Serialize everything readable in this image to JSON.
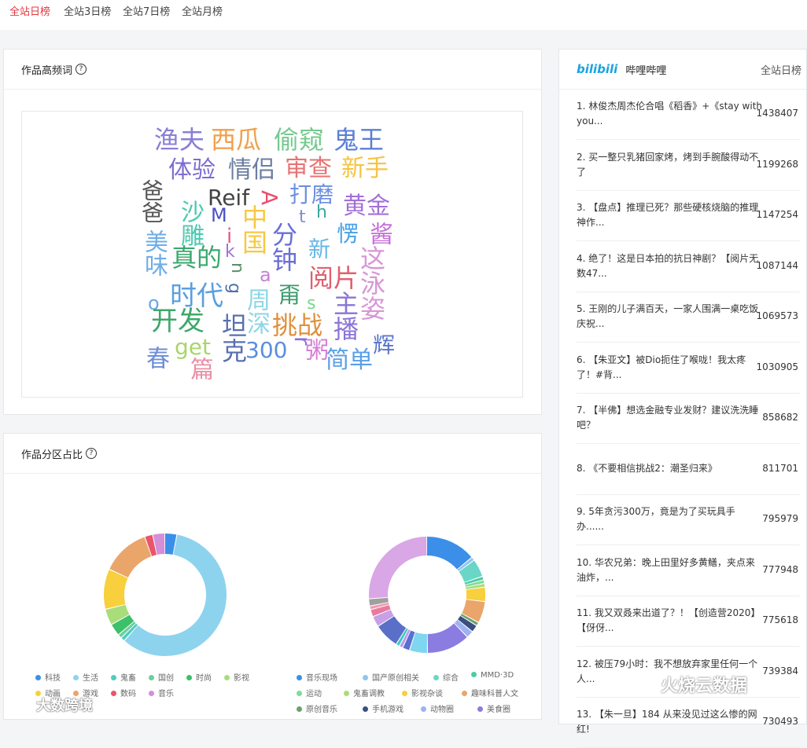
{
  "tabs": [
    "全站日榜",
    "全站3日榜",
    "全站7日榜",
    "全站月榜"
  ],
  "wordcloud_card": {
    "title": "作品高频词"
  },
  "words": [
    {
      "t": "渔夫",
      "c": "#8a7fd6"
    },
    {
      "t": "西瓜",
      "c": "#f0a04b"
    },
    {
      "t": "偷窥",
      "c": "#75c98f"
    },
    {
      "t": "鬼王",
      "c": "#5b7fd6"
    },
    {
      "t": "体验",
      "c": "#7d6bd1"
    },
    {
      "t": "情侣",
      "c": "#6c7ea0"
    },
    {
      "t": "审查",
      "c": "#e87272"
    },
    {
      "t": "新手",
      "c": "#f6c342"
    },
    {
      "t": "爸爸",
      "c": "#555"
    },
    {
      "t": "Reif",
      "c": "#444"
    },
    {
      "t": "A",
      "c": "#e8506e"
    },
    {
      "t": "打磨",
      "c": "#6c8fe0"
    },
    {
      "t": "黄金",
      "c": "#a36fd8"
    },
    {
      "t": "沙雕",
      "c": "#4cc9b0"
    },
    {
      "t": "M",
      "c": "#4a50c8"
    },
    {
      "t": "h",
      "c": "#3aa99f"
    },
    {
      "t": "t",
      "c": "#7d8fd6"
    },
    {
      "t": "中国",
      "c": "#f7c843"
    },
    {
      "t": "分钟",
      "c": "#6a6fd6"
    },
    {
      "t": "i",
      "c": "#e05a8a"
    },
    {
      "t": "愣",
      "c": "#47a0e6"
    },
    {
      "t": "酱",
      "c": "#c46fd6"
    },
    {
      "t": "美味",
      "c": "#6faee6"
    },
    {
      "t": "真的",
      "c": "#38a86c"
    },
    {
      "t": "k",
      "c": "#a86fd6"
    },
    {
      "t": "新",
      "c": "#66b8e6"
    },
    {
      "t": "这泳姿",
      "c": "#d896d6"
    },
    {
      "t": "a",
      "c": "#c880d6"
    },
    {
      "t": "阅片",
      "c": "#e0606f"
    },
    {
      "t": "n",
      "c": "#5a8f6a"
    },
    {
      "t": "g",
      "c": "#4b70b0"
    },
    {
      "t": "o",
      "c": "#6aa6e6"
    },
    {
      "t": "时代",
      "c": "#5a9fe0"
    },
    {
      "t": "周深",
      "c": "#8ed6e6"
    },
    {
      "t": "甭",
      "c": "#3a9a6a"
    },
    {
      "t": "s",
      "c": "#7ad68a"
    },
    {
      "t": "主播",
      "c": "#8a74d6"
    },
    {
      "t": "开发",
      "c": "#3ea86a"
    },
    {
      "t": "坦克",
      "c": "#5a6fb0"
    },
    {
      "t": "挑战",
      "c": "#e0903c"
    },
    {
      "t": "get",
      "c": "#a8d66a"
    },
    {
      "t": "300",
      "c": "#5a8ee0"
    },
    {
      "t": "r",
      "c": "#8a6fd6"
    },
    {
      "t": "粥",
      "c": "#d67fd6"
    },
    {
      "t": "简单",
      "c": "#5a9fe6"
    },
    {
      "t": "辉",
      "c": "#5a76c8"
    },
    {
      "t": "春",
      "c": "#6e8fd6"
    },
    {
      "t": "篇",
      "c": "#e890a6"
    }
  ],
  "pie_card": {
    "title": "作品分区占比"
  },
  "chart_data": [
    {
      "type": "pie",
      "legend": [
        "科技",
        "生活",
        "鬼畜",
        "国创",
        "时尚",
        "影视",
        "动画",
        "游戏",
        "数码",
        "音乐"
      ],
      "values": [
        3,
        55,
        1,
        1,
        3,
        4,
        10,
        12,
        2,
        3
      ],
      "colors": [
        "#3b8fe8",
        "#8ed3ee",
        "#4ecdc0",
        "#6bcfa0",
        "#3cc06a",
        "#a8dd7a",
        "#f8cf3c",
        "#eaa56a",
        "#e8556a",
        "#d48fd8"
      ]
    },
    {
      "type": "pie",
      "legend": [
        "音乐现场",
        "国产原创相关",
        "综合",
        "MMD·3D",
        "运动",
        "鬼畜调教",
        "影视杂谈",
        "趣味科普人文",
        "原创音乐",
        "手机游戏",
        "动物圈",
        "美食圈"
      ],
      "values": [
        14,
        1,
        5,
        1,
        1,
        1,
        4,
        6,
        1,
        2,
        2,
        12,
        5,
        2,
        1,
        1,
        7,
        3,
        2,
        1,
        2,
        26
      ],
      "colors": [
        "#3b8fe8",
        "#8ec6ee",
        "#6ad6c8",
        "#4ecca0",
        "#7fdc9a",
        "#a8dd7a",
        "#f8cf3c",
        "#eaa56a",
        "#6aa36a",
        "#3a4f80",
        "#9fb2f0",
        "#8a7ce0",
        "#7fd6f0",
        "#5a6fd0",
        "#b89af0",
        "#3ecbc0",
        "#5a6fc8",
        "#c8a0e6",
        "#e87aa0",
        "#f09ab0",
        "#a0a0a0",
        "#d9a6e6"
      ],
      "legend_colors": [
        "#3b8fe8",
        "#8ec6ee",
        "#6ad6c8",
        "#4ecca0",
        "#7fdc9a",
        "#a8dd7a",
        "#f8cf3c",
        "#eaa56a",
        "#6aa36a",
        "#3a4f80",
        "#9fb2f0",
        "#8a7ce0"
      ]
    }
  ],
  "rank": {
    "brand": "bilibili",
    "title": "哔哩哔哩",
    "scope": "全站日榜",
    "items": [
      {
        "title": "1. 林俊杰周杰伦合唱《稻香》+《stay with you...",
        "num": "1438407"
      },
      {
        "title": "2. 买一整只乳猪回家烤，烤到手腕酸得动不了",
        "num": "1199268"
      },
      {
        "title": "3. 【盘点】推理已死？那些硬核烧脑的推理神作...",
        "num": "1147254"
      },
      {
        "title": "4. 绝了！这是日本拍的抗日神剧？【阅片无数47...",
        "num": "1087144"
      },
      {
        "title": "5. 王刚的儿子满百天，一家人围满一桌吃饭庆祝...",
        "num": "1069573"
      },
      {
        "title": "6. 【朱亚文】被Dio扼住了喉咙！我太疼了！#背...",
        "num": "1030905"
      },
      {
        "title": "7. 【半佛】想选金融专业发财？建议洗洗睡吧？",
        "num": "858682"
      },
      {
        "title": "8. 《不要相信挑战2：潮圣归来》",
        "num": "811701"
      },
      {
        "title": "9. 5年贪污300万，竟是为了买玩具手办......",
        "num": "795979"
      },
      {
        "title": "10. 华农兄弟：晚上田里好多黄鳝，夹点来油炸，...",
        "num": "777948"
      },
      {
        "title": "11. 我又双叒来出道了？！【创造营2020】【伢伢...",
        "num": "775618"
      },
      {
        "title": "12. 被压79小时：我不想放弃家里任何一个人...",
        "num": "739384"
      },
      {
        "title": "13. 【朱一旦】184 从来没见过这么惨的网红!",
        "num": "730493"
      }
    ]
  },
  "watermarks": [
    "火烧云数据",
    "大数跨境"
  ]
}
